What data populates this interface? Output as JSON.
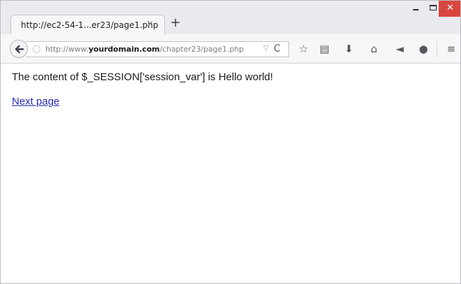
{
  "tab": {
    "title": "http://ec2-54-1...er23/page1.php",
    "close_glyph": "×"
  },
  "new_tab_glyph": "+",
  "window_controls": {
    "minimize_icon": "minimize-icon",
    "maximize_icon": "maximize-icon",
    "close_glyph": "✕"
  },
  "url": {
    "prefix": "http://www.",
    "domain": "yourdomain.com",
    "path": "/chapter23/page1.php",
    "dropdown_glyph": "▽",
    "reload_glyph": "C"
  },
  "toolbar": [
    {
      "icon": "bookmark-star-icon",
      "glyph": "☆"
    },
    {
      "icon": "reading-list-icon",
      "glyph": "▤"
    },
    {
      "icon": "download-icon",
      "glyph": "⬇"
    },
    {
      "icon": "home-icon",
      "glyph": "⌂"
    },
    {
      "icon": "send-icon",
      "glyph": "◄"
    },
    {
      "icon": "chat-icon",
      "glyph": "●"
    },
    {
      "icon": "menu-icon",
      "glyph": "≡"
    }
  ],
  "page": {
    "message": "The content of $_SESSION['session_var'] is Hello world!",
    "link": "Next page"
  }
}
